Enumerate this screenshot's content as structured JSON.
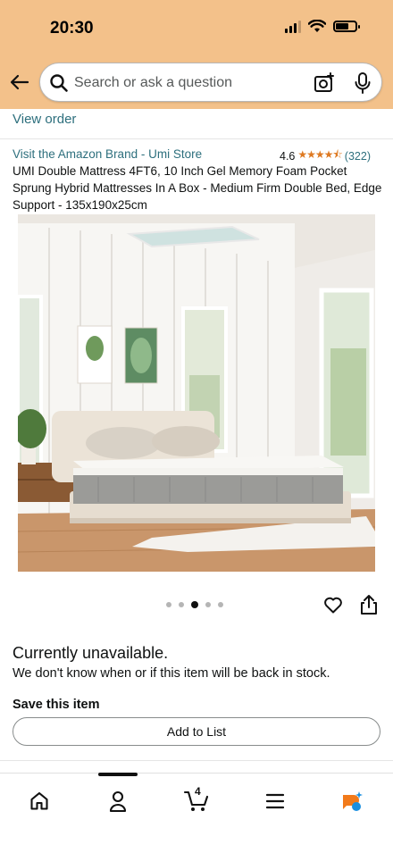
{
  "status_bar": {
    "time": "20:30"
  },
  "search": {
    "placeholder": "Search or ask a question"
  },
  "order": {
    "view_order_label": "View order"
  },
  "product": {
    "brand_link": "Visit the Amazon Brand - Umi Store",
    "rating_value": "4.6",
    "rating_stars": 4.5,
    "review_count": "(322)",
    "title": "UMI Double Mattress 4FT6, 10 Inch Gel Memory Foam Pocket Sprung Hybrid Mattresses In A Box - Medium Firm Double Bed, Edge Support - 135x190x25cm",
    "image_count": 5,
    "active_image_index": 2
  },
  "availability": {
    "status": "Currently unavailable.",
    "note": "We don't know when or if this item will be back in stock."
  },
  "save": {
    "heading": "Save this item",
    "add_to_list_label": "Add to List"
  },
  "bottom_nav": {
    "items": [
      "home-icon",
      "account-icon",
      "cart-icon",
      "menu-icon",
      "rufus-icon"
    ],
    "cart_count": "4",
    "active_item": "account"
  },
  "colors": {
    "header_bg": "#f3c18a",
    "link": "#2d6f7d",
    "star": "#de7921"
  }
}
